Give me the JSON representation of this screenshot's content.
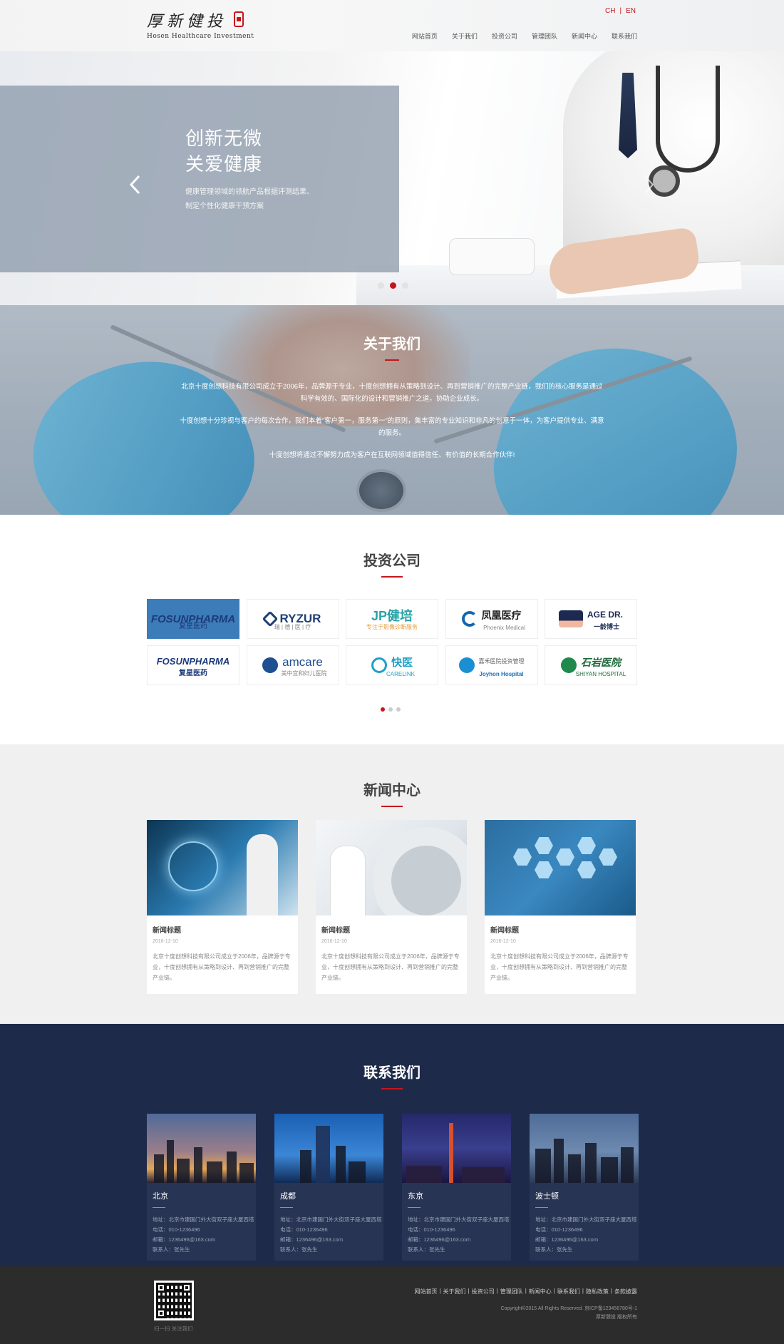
{
  "header": {
    "logo_cn": "厚新健投",
    "logo_en": "Hosen Healthcare Investment",
    "lang": {
      "ch": "CH",
      "sep": "|",
      "en": "EN"
    },
    "nav": [
      "网站首页",
      "关于我们",
      "投资公司",
      "管理团队",
      "新闻中心",
      "联系我们"
    ]
  },
  "hero": {
    "title_line1": "创新无微",
    "title_line2": "关爱健康",
    "desc_line1": "健康管理领域的领航产品根据评测结果、",
    "desc_line2": "制定个性化健康干预方案",
    "slides": 3,
    "active_slide": 2
  },
  "about": {
    "title": "关于我们",
    "p1": "北京十度创想科技有限公司成立于2006年，品牌源于专业，十度创想拥有从策略到设计、再到营销推广的完整产业链，我们的核心服务是通过科学有效的、国际化的设计和营销推广之道，协助企业成长。",
    "p2": "十度创想十分珍视与客户的每次合作，我们本着“客户第一，服务第一”的原则，集丰富的专业知识和非凡的创意于一体，为客户提供专业、满意的服务。",
    "p3": "十度创想将通过不懈努力成为客户在互联网领域值得信任、有价值的长期合作伙伴!"
  },
  "portfolio": {
    "title": "投资公司",
    "logos": [
      {
        "name": "FOSUNPHARMA",
        "sub": "复星医药"
      },
      {
        "name": "RYZUR",
        "sub": "瑞 | 德 | 医 | 疗"
      },
      {
        "name": "JP健培",
        "sub": "专注于影像诊断服务"
      },
      {
        "name": "凤凰医疗",
        "sub": "Phoenix Medical"
      },
      {
        "name": "AGE DR.",
        "sub": "一龄博士"
      },
      {
        "name": "FOSUNPHARMA",
        "sub": "复星医药"
      },
      {
        "name": "amcare",
        "sub": "美中宜和妇儿医院"
      },
      {
        "name": "快医",
        "sub": "CARELINK"
      },
      {
        "name": "嘉禾医院投资管理",
        "sub": "Joyhon Hospital"
      },
      {
        "name": "石岩医院",
        "sub": "SHIYAN HOSPITAL"
      }
    ],
    "pages": 3
  },
  "news": {
    "title": "新闻中心",
    "items": [
      {
        "title": "新闻标题",
        "date": "2016-12-10",
        "desc": "北京十度创想科技有限公司成立于2006年，品牌源于专业，十度创想拥有从策略到设计、再到营销推广的完整产业链。"
      },
      {
        "title": "新闻标题",
        "date": "2016-12-10",
        "desc": "北京十度创想科技有限公司成立于2006年，品牌源于专业，十度创想拥有从策略到设计、再到营销推广的完整产业链。"
      },
      {
        "title": "新闻标题",
        "date": "2016-12-10",
        "desc": "北京十度创想科技有限公司成立于2006年，品牌源于专业，十度创想拥有从策略到设计、再到营销推广的完整产业链。"
      }
    ]
  },
  "contact": {
    "title": "联系我们",
    "cities": [
      {
        "name": "北京",
        "address": "地址：北京市建国门外大街双子座大厦西塔",
        "phone": "电话：010-1236496",
        "email": "邮箱：1236496@163.com",
        "person": "联系人：张先生"
      },
      {
        "name": "成都",
        "address": "地址：北京市建国门外大街双子座大厦西塔",
        "phone": "电话：010-1236496",
        "email": "邮箱：1236496@163.com",
        "person": "联系人：张先生"
      },
      {
        "name": "东京",
        "address": "地址：北京市建国门外大街双子座大厦西塔",
        "phone": "电话：010-1236496",
        "email": "邮箱：1236496@163.com",
        "person": "联系人：张先生"
      },
      {
        "name": "波士顿",
        "address": "地址：北京市建国门外大街双子座大厦西塔",
        "phone": "电话：010-1236496",
        "email": "邮箱：1236496@163.com",
        "person": "联系人：张先生"
      }
    ]
  },
  "footer": {
    "qr_label": "扫一扫  关注我们",
    "links": [
      "网站首页",
      "关于我们",
      "投资公司",
      "管理团队",
      "新闻中心",
      "联系我们",
      "隐私政策",
      "条款披露"
    ],
    "copyright": "Copyright©2015 All Rights Reserved. 京ICP备123456780号-1",
    "owner": "厚新健投 版权所有"
  },
  "colors": {
    "accent": "#c4161c",
    "contact_bg": "#1e2a4a",
    "footer_bg": "#2c2c2c",
    "news_bg": "#f0f0f0"
  }
}
